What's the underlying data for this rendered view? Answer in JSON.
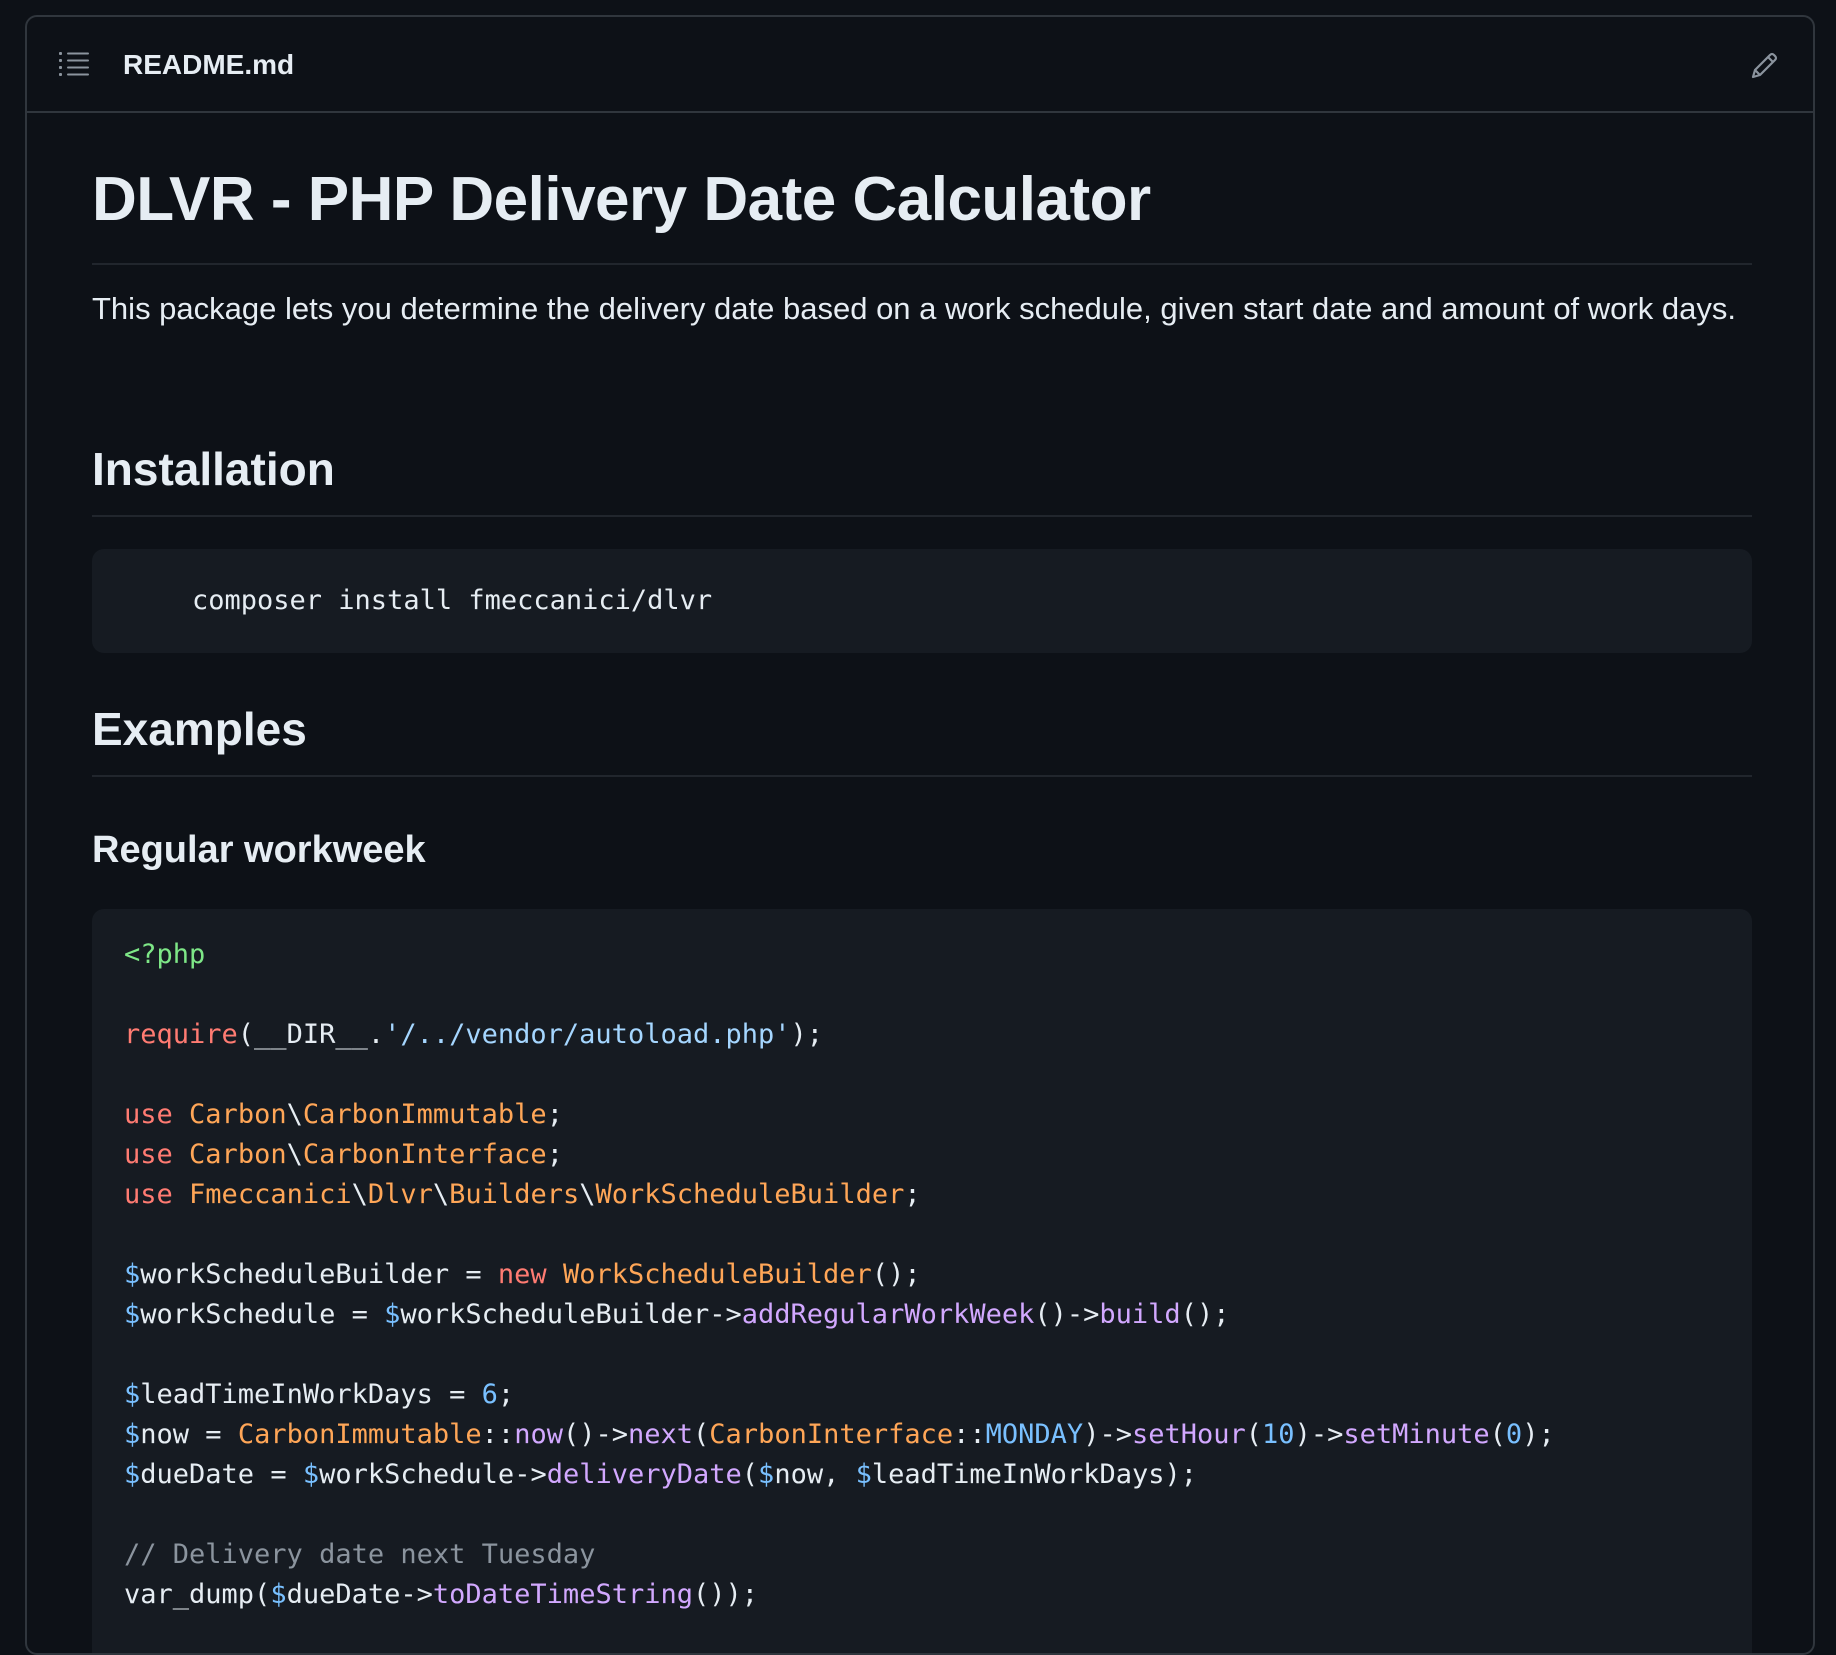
{
  "header": {
    "filename": "README.md",
    "toc_icon": "list-unordered-icon",
    "edit_icon": "pencil-icon"
  },
  "content": {
    "title": "DLVR - PHP Delivery Date Calculator",
    "intro": "This package lets you determine the delivery date based on a work schedule, given start date and amount of work days.",
    "installation_heading": "Installation",
    "install_command": "composer install fmeccanici/dlvr",
    "examples_heading": "Examples",
    "regular_workweek_heading": "Regular workweek"
  },
  "code": {
    "php_open": "<?php",
    "require_kw": "require",
    "require_open": "(__DIR__.",
    "require_path": "'/../vendor/autoload.php'",
    "require_close": ");",
    "use_kw": "use",
    "ns_carbon": "Carbon",
    "bs": "\\",
    "carbon_immutable": "CarbonImmutable",
    "carbon_interface": "CarbonInterface",
    "ns_fmeccanici": "Fmeccanici",
    "ns_dlvr": "Dlvr",
    "ns_builders": "Builders",
    "work_schedule_builder_cls": "WorkScheduleBuilder",
    "semicolon": ";",
    "var_wsb": "$",
    "name_wsb": "workScheduleBuilder",
    "assign": " = ",
    "new_kw": "new",
    "paren_semi": "();",
    "name_ws": "workSchedule",
    "arrow": "->",
    "add_regular": "addRegularWorkWeek",
    "parens": "()",
    "build": "build",
    "name_lead": "leadTimeInWorkDays",
    "six": "6",
    "name_now": "now",
    "double_colon": "::",
    "now_fn": "now",
    "next_fn": "next",
    "open_paren": "(",
    "monday": "MONDAY",
    "close_paren": ")",
    "set_hour": "setHour",
    "ten": "10",
    "set_minute": "setMinute",
    "zero": "0",
    "close_semi": ");",
    "name_due": "dueDate",
    "delivery_date": "deliveryDate",
    "comma_space": ", ",
    "comment": "// Delivery date next Tuesday",
    "var_dump": "var_dump(",
    "to_dts": "toDateTimeString",
    "end_call": "());"
  }
}
